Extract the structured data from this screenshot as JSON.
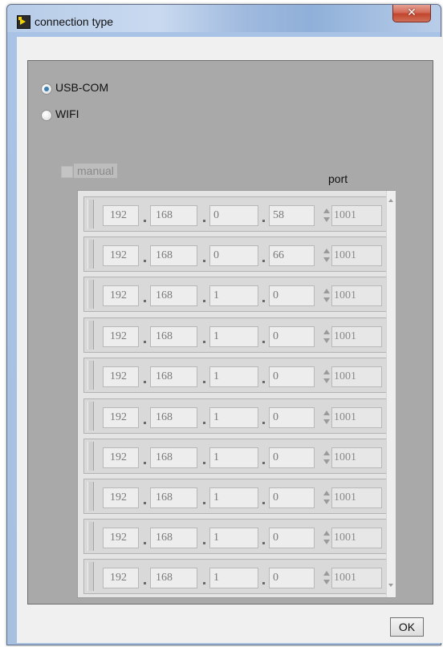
{
  "window": {
    "title": "connection type",
    "close_label": "✕"
  },
  "connection": {
    "options": [
      "USB-COM",
      "WIFI"
    ],
    "selected": "USB-COM",
    "manual_label": "manual",
    "manual_checked": false,
    "port_heading": "port"
  },
  "ip_rows": [
    {
      "octets": [
        "192",
        "168",
        "0",
        "58"
      ],
      "port": "1001"
    },
    {
      "octets": [
        "192",
        "168",
        "0",
        "66"
      ],
      "port": "1001"
    },
    {
      "octets": [
        "192",
        "168",
        "1",
        "0"
      ],
      "port": "1001"
    },
    {
      "octets": [
        "192",
        "168",
        "1",
        "0"
      ],
      "port": "1001"
    },
    {
      "octets": [
        "192",
        "168",
        "1",
        "0"
      ],
      "port": "1001"
    },
    {
      "octets": [
        "192",
        "168",
        "1",
        "0"
      ],
      "port": "1001"
    },
    {
      "octets": [
        "192",
        "168",
        "1",
        "0"
      ],
      "port": "1001"
    },
    {
      "octets": [
        "192",
        "168",
        "1",
        "0"
      ],
      "port": "1001"
    },
    {
      "octets": [
        "192",
        "168",
        "1",
        "0"
      ],
      "port": "1001"
    },
    {
      "octets": [
        "192",
        "168",
        "1",
        "0"
      ],
      "port": "1001"
    }
  ],
  "buttons": {
    "ok_label": "OK"
  }
}
